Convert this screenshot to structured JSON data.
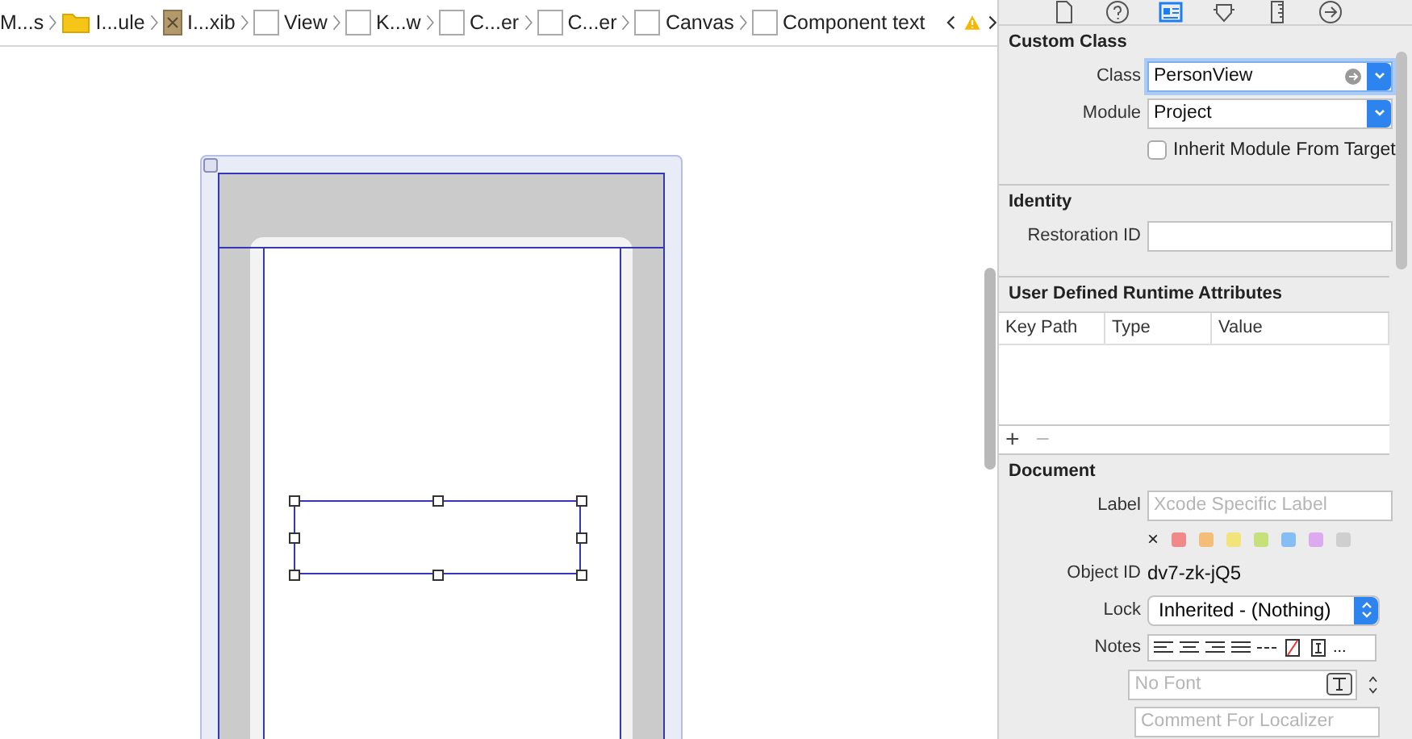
{
  "breadcrumb": [
    {
      "kind": "none",
      "label": "M...s"
    },
    {
      "kind": "folder",
      "label": "I...ule"
    },
    {
      "kind": "xib",
      "label": "I...xib"
    },
    {
      "kind": "view",
      "label": "View"
    },
    {
      "kind": "view",
      "label": "K...w"
    },
    {
      "kind": "view",
      "label": "C...er"
    },
    {
      "kind": "view",
      "label": "C...er"
    },
    {
      "kind": "view",
      "label": "Canvas"
    },
    {
      "kind": "view",
      "label": "Component text"
    }
  ],
  "inspector_tabs": [
    {
      "kind": "file",
      "selected": false
    },
    {
      "kind": "help",
      "selected": false
    },
    {
      "kind": "identity",
      "selected": true
    },
    {
      "kind": "attributes",
      "selected": false
    },
    {
      "kind": "size",
      "selected": false
    },
    {
      "kind": "connections",
      "selected": false
    }
  ],
  "custom_class": {
    "title": "Custom Class",
    "class_label": "Class",
    "class_value": "PersonView",
    "module_label": "Module",
    "module_value": "Project",
    "inherit_label": "Inherit Module From Target",
    "inherit_checked": false
  },
  "identity": {
    "title": "Identity",
    "restoration_label": "Restoration ID"
  },
  "runtime_attributes": {
    "title": "User Defined Runtime Attributes",
    "columns": [
      "Key Path",
      "Type",
      "Value"
    ],
    "add": "+",
    "remove": "−"
  },
  "document": {
    "title": "Document",
    "label_label": "Label",
    "label_placeholder": "Xcode Specific Label",
    "clear": "×",
    "colors": [
      {
        "color": "#f08a8a"
      },
      {
        "color": "#f5be78"
      },
      {
        "color": "#f2e47a"
      },
      {
        "color": "#c6e07a"
      },
      {
        "color": "#86bdf5"
      },
      {
        "color": "#dcaaf0"
      },
      {
        "color": "#cfcfcf"
      }
    ],
    "object_id_label": "Object ID",
    "object_id": "dv7-zk-jQ5",
    "lock_label": "Lock",
    "lock_value": "Inherited - (Nothing)",
    "notes_label": "Notes",
    "more": "...",
    "font_placeholder": "No Font",
    "comment_placeholder": "Comment For Localizer"
  }
}
